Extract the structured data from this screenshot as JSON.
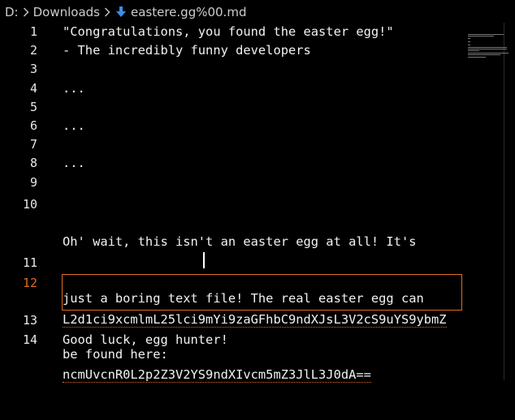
{
  "breadcrumb": {
    "drive": "D:",
    "folder": "Downloads",
    "file": "eastere.gg%00.md"
  },
  "editor": {
    "active_line": "12",
    "lines": [
      {
        "number": "1",
        "text": "\"Congratulations, you found the easter egg!\""
      },
      {
        "number": "2",
        "text": "- The incredibly funny developers"
      },
      {
        "number": "3",
        "text": ""
      },
      {
        "number": "4",
        "text": "..."
      },
      {
        "number": "5",
        "text": ""
      },
      {
        "number": "6",
        "text": "..."
      },
      {
        "number": "7",
        "text": ""
      },
      {
        "number": "8",
        "text": "..."
      },
      {
        "number": "9",
        "text": ""
      },
      {
        "number": "10",
        "text_wrapped": [
          "Oh' wait, this isn't an easter egg at all! It's",
          "just a boring text file! The real easter egg can",
          "be found here:"
        ]
      },
      {
        "number": "11",
        "text": ""
      },
      {
        "number": "12",
        "text_wrapped": [
          "L2d1ci9xcmlmL25lci9mYi9zaGFhbC9ndXJsL3V2cS9uYS9ybmZ",
          "ncmUvcnR0L2p2Z3V2YS9ndXIvcm5mZ3JlL3J0dA=="
        ]
      },
      {
        "number": "13",
        "text": ""
      },
      {
        "number": "14",
        "text": "Good luck, egg hunter!"
      }
    ]
  },
  "icons": {
    "separator": "chevron-right-icon",
    "file_type": "markdown-icon"
  },
  "colors": {
    "background": "#000000",
    "text": "#f2f2f2",
    "line_number": "#e8e8e8",
    "active_line_number": "#e36b1f",
    "markdown_icon": "#3a8ee6"
  }
}
